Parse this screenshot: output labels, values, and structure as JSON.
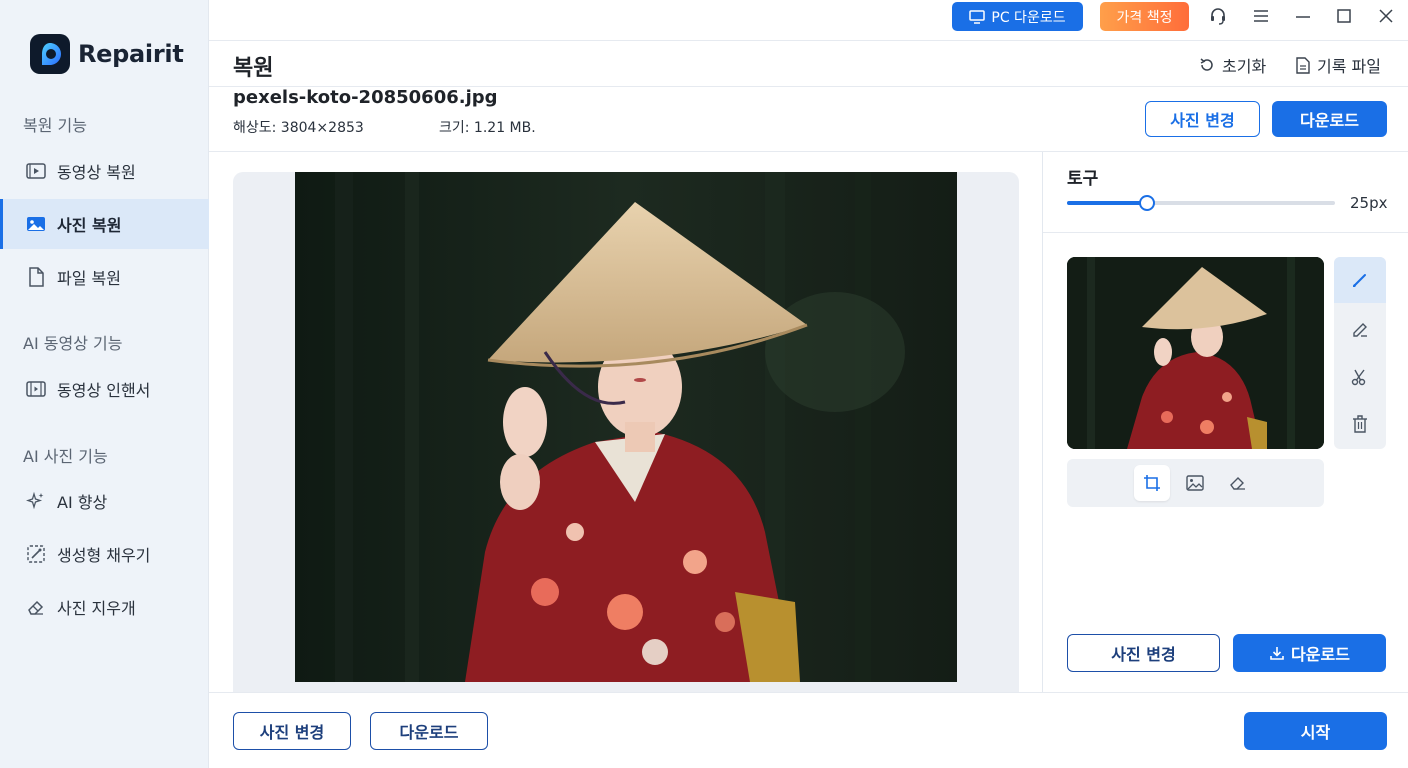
{
  "app": {
    "name": "Repairit"
  },
  "topbar": {
    "pc_download": "PC 다운로드",
    "pricing": "가격 책정"
  },
  "sidebar": {
    "sections": [
      {
        "title": "복원 기능",
        "items": [
          {
            "label": "동영상 복원",
            "icon": "video-icon"
          },
          {
            "label": "사진 복원",
            "icon": "image-icon",
            "active": true
          },
          {
            "label": "파일 복원",
            "icon": "file-icon"
          }
        ]
      },
      {
        "title": "AI 동영상 기능",
        "items": [
          {
            "label": "동영상 인핸서",
            "icon": "film-icon"
          }
        ]
      },
      {
        "title": "AI 사진 기능",
        "items": [
          {
            "label": "AI 향상",
            "icon": "sparkle-icon"
          },
          {
            "label": "생성형 채우기",
            "icon": "generative-fill-icon"
          },
          {
            "label": "사진 지우개",
            "icon": "eraser-icon"
          }
        ]
      }
    ]
  },
  "header": {
    "title": "복원",
    "reset": "초기화",
    "log": "기록 파일"
  },
  "file": {
    "name": "pexels-koto-20850606.jpg",
    "resolution": "해상도: 3804×2853",
    "size": "크기: 1.21 MB."
  },
  "actions": {
    "change_photo": "사진 변경",
    "download": "다운로드",
    "start": "시작"
  },
  "tools": {
    "title": "토구",
    "brush_size": "25px",
    "brush_fraction": 0.3
  },
  "colors": {
    "accent": "#1a6fe6",
    "pricing_gradient_start": "#ff9f4a",
    "pricing_gradient_end": "#ff6d3a",
    "sidebar_bg": "#eef3f9"
  }
}
